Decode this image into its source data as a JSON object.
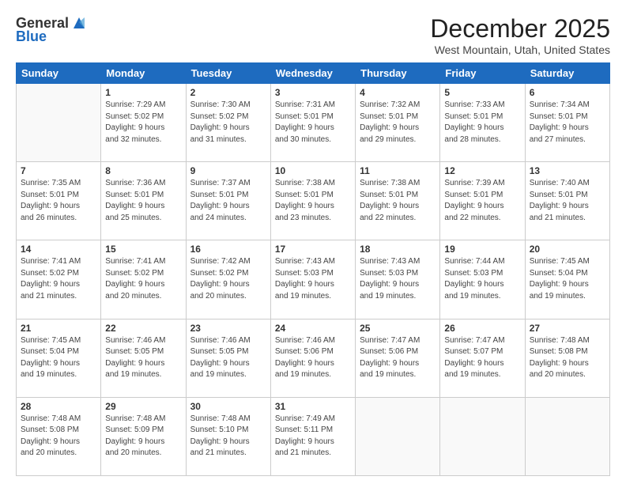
{
  "header": {
    "logo_line1": "General",
    "logo_line2": "Blue",
    "month_title": "December 2025",
    "location": "West Mountain, Utah, United States"
  },
  "days_of_week": [
    "Sunday",
    "Monday",
    "Tuesday",
    "Wednesday",
    "Thursday",
    "Friday",
    "Saturday"
  ],
  "weeks": [
    [
      {
        "day": "",
        "info": ""
      },
      {
        "day": "1",
        "info": "Sunrise: 7:29 AM\nSunset: 5:02 PM\nDaylight: 9 hours\nand 32 minutes."
      },
      {
        "day": "2",
        "info": "Sunrise: 7:30 AM\nSunset: 5:02 PM\nDaylight: 9 hours\nand 31 minutes."
      },
      {
        "day": "3",
        "info": "Sunrise: 7:31 AM\nSunset: 5:01 PM\nDaylight: 9 hours\nand 30 minutes."
      },
      {
        "day": "4",
        "info": "Sunrise: 7:32 AM\nSunset: 5:01 PM\nDaylight: 9 hours\nand 29 minutes."
      },
      {
        "day": "5",
        "info": "Sunrise: 7:33 AM\nSunset: 5:01 PM\nDaylight: 9 hours\nand 28 minutes."
      },
      {
        "day": "6",
        "info": "Sunrise: 7:34 AM\nSunset: 5:01 PM\nDaylight: 9 hours\nand 27 minutes."
      }
    ],
    [
      {
        "day": "7",
        "info": "Sunrise: 7:35 AM\nSunset: 5:01 PM\nDaylight: 9 hours\nand 26 minutes."
      },
      {
        "day": "8",
        "info": "Sunrise: 7:36 AM\nSunset: 5:01 PM\nDaylight: 9 hours\nand 25 minutes."
      },
      {
        "day": "9",
        "info": "Sunrise: 7:37 AM\nSunset: 5:01 PM\nDaylight: 9 hours\nand 24 minutes."
      },
      {
        "day": "10",
        "info": "Sunrise: 7:38 AM\nSunset: 5:01 PM\nDaylight: 9 hours\nand 23 minutes."
      },
      {
        "day": "11",
        "info": "Sunrise: 7:38 AM\nSunset: 5:01 PM\nDaylight: 9 hours\nand 22 minutes."
      },
      {
        "day": "12",
        "info": "Sunrise: 7:39 AM\nSunset: 5:01 PM\nDaylight: 9 hours\nand 22 minutes."
      },
      {
        "day": "13",
        "info": "Sunrise: 7:40 AM\nSunset: 5:01 PM\nDaylight: 9 hours\nand 21 minutes."
      }
    ],
    [
      {
        "day": "14",
        "info": "Sunrise: 7:41 AM\nSunset: 5:02 PM\nDaylight: 9 hours\nand 21 minutes."
      },
      {
        "day": "15",
        "info": "Sunrise: 7:41 AM\nSunset: 5:02 PM\nDaylight: 9 hours\nand 20 minutes."
      },
      {
        "day": "16",
        "info": "Sunrise: 7:42 AM\nSunset: 5:02 PM\nDaylight: 9 hours\nand 20 minutes."
      },
      {
        "day": "17",
        "info": "Sunrise: 7:43 AM\nSunset: 5:03 PM\nDaylight: 9 hours\nand 19 minutes."
      },
      {
        "day": "18",
        "info": "Sunrise: 7:43 AM\nSunset: 5:03 PM\nDaylight: 9 hours\nand 19 minutes."
      },
      {
        "day": "19",
        "info": "Sunrise: 7:44 AM\nSunset: 5:03 PM\nDaylight: 9 hours\nand 19 minutes."
      },
      {
        "day": "20",
        "info": "Sunrise: 7:45 AM\nSunset: 5:04 PM\nDaylight: 9 hours\nand 19 minutes."
      }
    ],
    [
      {
        "day": "21",
        "info": "Sunrise: 7:45 AM\nSunset: 5:04 PM\nDaylight: 9 hours\nand 19 minutes."
      },
      {
        "day": "22",
        "info": "Sunrise: 7:46 AM\nSunset: 5:05 PM\nDaylight: 9 hours\nand 19 minutes."
      },
      {
        "day": "23",
        "info": "Sunrise: 7:46 AM\nSunset: 5:05 PM\nDaylight: 9 hours\nand 19 minutes."
      },
      {
        "day": "24",
        "info": "Sunrise: 7:46 AM\nSunset: 5:06 PM\nDaylight: 9 hours\nand 19 minutes."
      },
      {
        "day": "25",
        "info": "Sunrise: 7:47 AM\nSunset: 5:06 PM\nDaylight: 9 hours\nand 19 minutes."
      },
      {
        "day": "26",
        "info": "Sunrise: 7:47 AM\nSunset: 5:07 PM\nDaylight: 9 hours\nand 19 minutes."
      },
      {
        "day": "27",
        "info": "Sunrise: 7:48 AM\nSunset: 5:08 PM\nDaylight: 9 hours\nand 20 minutes."
      }
    ],
    [
      {
        "day": "28",
        "info": "Sunrise: 7:48 AM\nSunset: 5:08 PM\nDaylight: 9 hours\nand 20 minutes."
      },
      {
        "day": "29",
        "info": "Sunrise: 7:48 AM\nSunset: 5:09 PM\nDaylight: 9 hours\nand 20 minutes."
      },
      {
        "day": "30",
        "info": "Sunrise: 7:48 AM\nSunset: 5:10 PM\nDaylight: 9 hours\nand 21 minutes."
      },
      {
        "day": "31",
        "info": "Sunrise: 7:49 AM\nSunset: 5:11 PM\nDaylight: 9 hours\nand 21 minutes."
      },
      {
        "day": "",
        "info": ""
      },
      {
        "day": "",
        "info": ""
      },
      {
        "day": "",
        "info": ""
      }
    ]
  ]
}
